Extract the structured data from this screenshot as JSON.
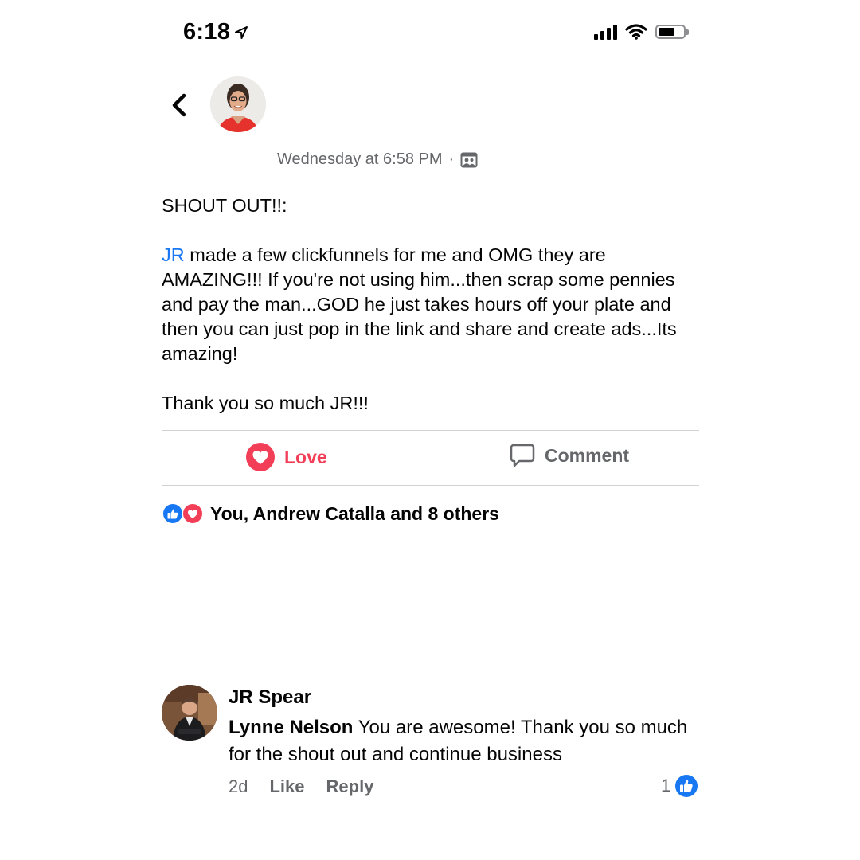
{
  "status_bar": {
    "time": "6:18"
  },
  "post": {
    "timestamp": "Wednesday at 6:58 PM",
    "separator": "·",
    "heading": "SHOUT OUT!!:",
    "mention": "JR",
    "body_rest": " made a few clickfunnels for me and OMG they are AMAZING!!! If you're not using him...then scrap some pennies and pay the man...GOD he just takes hours off your plate and then you can just pop in the link and share and create ads...Its amazing!",
    "closing": "Thank you so much JR!!!"
  },
  "actions": {
    "love_label": "Love",
    "comment_label": "Comment"
  },
  "reactions": {
    "summary": "You, Andrew Catalla and 8 others"
  },
  "comment": {
    "author": "JR Spear",
    "tagged": "Lynne Nelson",
    "text": " You are awesome! Thank you so much for the shout out and continue business",
    "age": "2d",
    "like_label": "Like",
    "reply_label": "Reply",
    "like_count": "1"
  },
  "colors": {
    "accent_blue": "#1877f2",
    "love_red": "#f33e58",
    "muted": "#65676b"
  },
  "icons": [
    "location-arrow-icon",
    "signal-icon",
    "wifi-icon",
    "battery-icon",
    "back-chevron-icon",
    "group-audience-icon",
    "love-heart-icon",
    "comment-bubble-icon",
    "like-thumb-icon"
  ]
}
